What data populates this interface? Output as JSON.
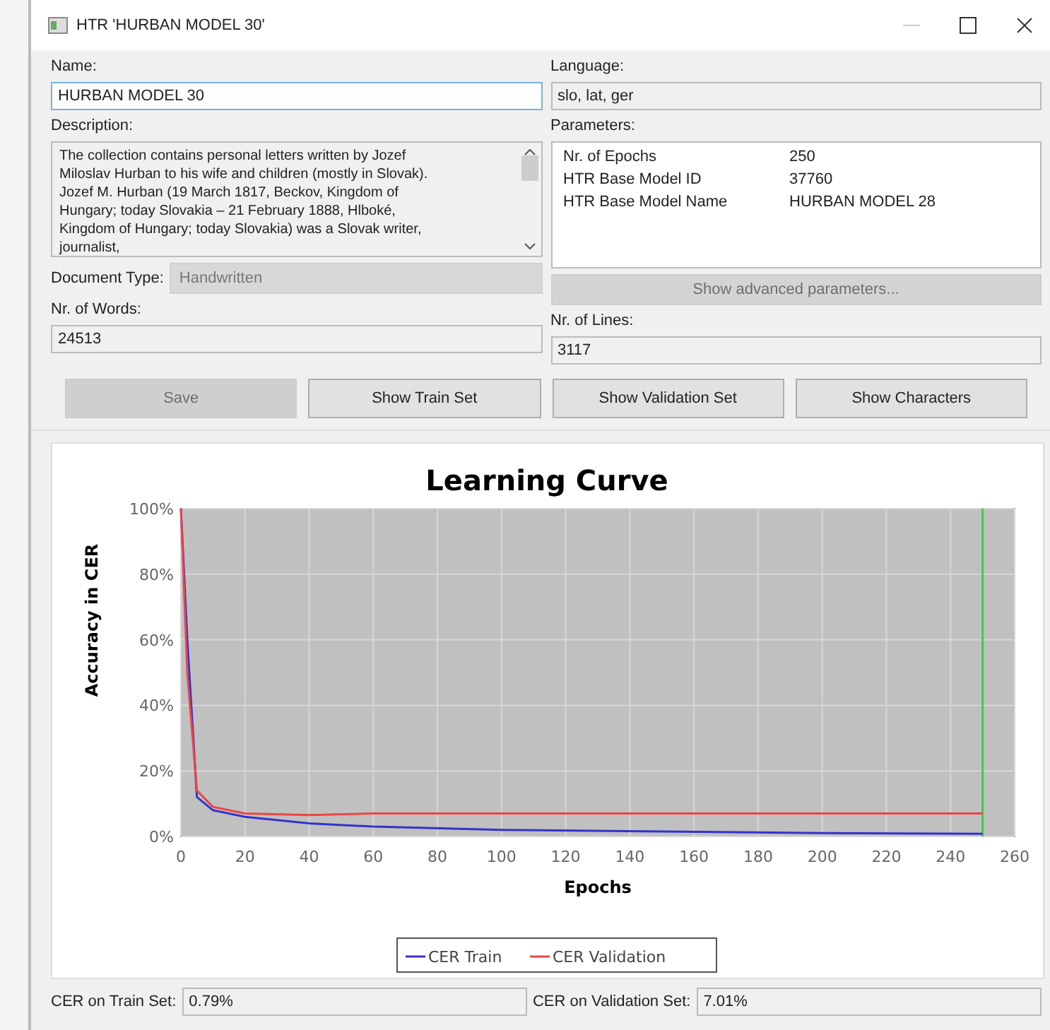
{
  "window": {
    "title": "HTR 'HURBAN MODEL 30'"
  },
  "name": {
    "label": "Name:",
    "value": "HURBAN MODEL 30"
  },
  "language": {
    "label": "Language:",
    "value": "slo, lat, ger"
  },
  "description": {
    "label": "Description:",
    "value": "The collection contains personal letters written by Jozef Miloslav Hurban to his wife and children (mostly in Slovak). Jozef M. Hurban (19 March 1817, Beckov, Kingdom of Hungary; today Slovakia – 21 February 1888, Hlboké, Kingdom of Hungary; today Slovakia) was a Slovak writer, journalist,"
  },
  "parameters": {
    "label": "Parameters:",
    "rows": [
      {
        "key": "Nr. of Epochs",
        "value": "250"
      },
      {
        "key": "HTR Base Model ID",
        "value": "37760"
      },
      {
        "key": "HTR Base Model Name",
        "value": "HURBAN MODEL 28"
      }
    ]
  },
  "document_type": {
    "label": "Document Type:",
    "value": "Handwritten",
    "disabled": true
  },
  "advanced_button": {
    "label": "Show advanced parameters...",
    "disabled": true
  },
  "words": {
    "label": "Nr. of Words:",
    "value": "24513"
  },
  "lines": {
    "label": "Nr. of Lines:",
    "value": "3117"
  },
  "buttons": [
    {
      "label": "Save",
      "disabled": true
    },
    {
      "label": "Show Train Set",
      "disabled": false
    },
    {
      "label": "Show Validation Set",
      "disabled": false
    },
    {
      "label": "Show Characters",
      "disabled": false
    }
  ],
  "chart": {
    "chart_data": {
      "type": "line",
      "title": "Learning Curve",
      "xlabel": "Epochs",
      "ylabel": "Accuracy in CER",
      "x": [
        0,
        2,
        5,
        10,
        20,
        40,
        60,
        100,
        150,
        200,
        250
      ],
      "series": [
        {
          "name": "CER Train",
          "color": "#3333cc",
          "values": [
            100,
            60,
            12,
            8,
            6,
            4,
            3,
            2,
            1.5,
            1,
            0.8
          ]
        },
        {
          "name": "CER Validation",
          "color": "#ee4444",
          "values": [
            100,
            50,
            14,
            9,
            7,
            6.5,
            7,
            7,
            7,
            7,
            7
          ]
        }
      ],
      "xlim": [
        0,
        260
      ],
      "ylim": [
        0,
        100
      ],
      "xticks": [
        0,
        20,
        40,
        60,
        80,
        100,
        120,
        140,
        160,
        180,
        200,
        220,
        240,
        260
      ],
      "yticks": [
        {
          "value": 0,
          "label": "0%"
        },
        {
          "value": 20,
          "label": "20%"
        },
        {
          "value": 40,
          "label": "40%"
        },
        {
          "value": 60,
          "label": "60%"
        },
        {
          "value": 80,
          "label": "80%"
        },
        {
          "value": 100,
          "label": "100%"
        }
      ],
      "grid": true,
      "legend": "bottom",
      "ref_lines": [
        {
          "axis": "x",
          "value": 250,
          "color": "#44cc44"
        }
      ]
    }
  },
  "status": [
    {
      "label": "CER on Train Set:",
      "value": "0.79%"
    },
    {
      "label": "CER on Validation Set:",
      "value": "7.01%"
    }
  ]
}
